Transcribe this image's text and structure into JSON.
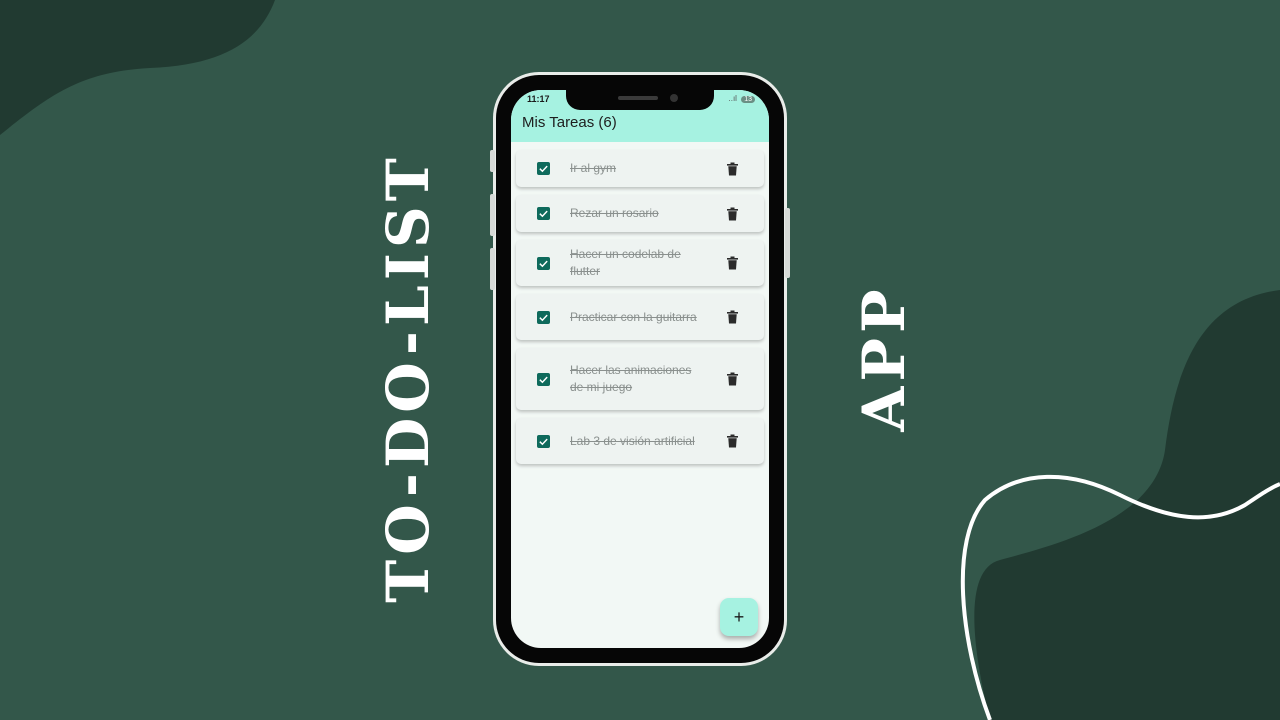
{
  "banner": {
    "title_left": "TO-DO-LIST",
    "title_right": "APP"
  },
  "status_bar": {
    "time": "11:17",
    "signal": "..ıl",
    "battery": "13"
  },
  "app": {
    "title": "Mis Tareas (6)",
    "accent_color": "#a6f2e1",
    "checkbox_color": "#0e6a5c",
    "tasks": [
      {
        "text": "Ir al gym",
        "done": true
      },
      {
        "text": "Rezar un rosario",
        "done": true
      },
      {
        "text": "Hacer un codelab de flutter",
        "done": true
      },
      {
        "text": "Practicar con la guitarra",
        "done": true
      },
      {
        "text": "Hacer las animaciones de mi juego",
        "done": true
      },
      {
        "text": "Lab 3 de visión artificial",
        "done": true
      }
    ],
    "fab_label": "+",
    "icons": {
      "checkbox": "check-icon",
      "delete": "trash-icon",
      "add": "plus-icon"
    }
  },
  "colors": {
    "background": "#33574a",
    "shape_dark": "#213a31",
    "curve": "#ffffff"
  }
}
